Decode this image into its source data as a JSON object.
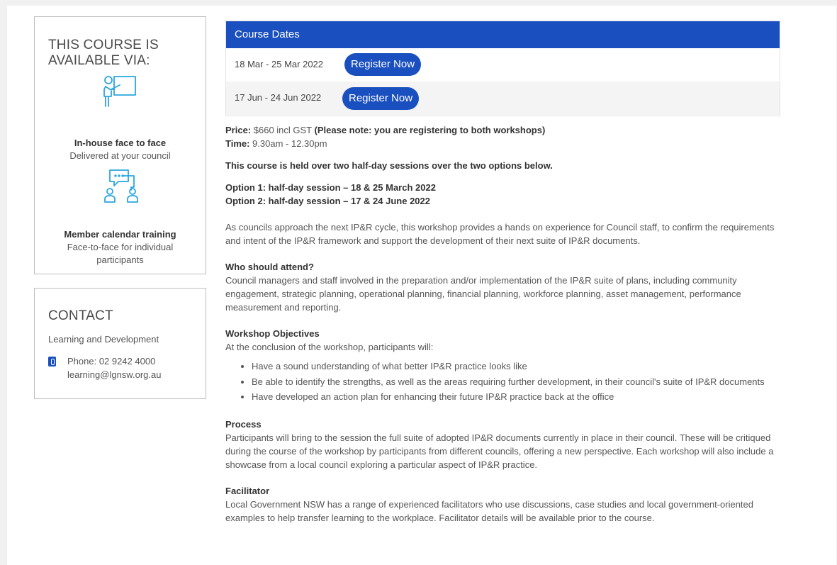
{
  "availability": {
    "title": "THIS COURSE IS AVAILABLE VIA:",
    "options": [
      {
        "icon": "presenter-icon",
        "title": "In-house face to face",
        "subtitle": "Delivered at your council"
      },
      {
        "icon": "discussion-icon",
        "title": "Member calendar training",
        "subtitle": "Face-to-face for individual participants"
      }
    ]
  },
  "contact": {
    "title": "CONTACT",
    "department": "Learning and Development",
    "phone": "Phone: 02 9242 4000",
    "email": "learning@lgnsw.org.au"
  },
  "course_dates": {
    "heading": "Course Dates",
    "rows": [
      {
        "date": "18 Mar - 25 Mar 2022",
        "button": "Register Now"
      },
      {
        "date": "17 Jun - 24 Jun 2022",
        "button": "Register Now"
      }
    ]
  },
  "details": {
    "price_label": "Price:",
    "price_value": " $660 incl GST ",
    "price_note": "(Please note: you are registering to both workshops)",
    "time_label": "Time:",
    "time_value": " 9.30am - 12.30pm",
    "held_over": "This course is held over two half-day sessions over the two options below.",
    "option1": "Option 1: half-day session – 18 & 25 March 2022",
    "option2": "Option 2: half-day session – 17 & 24 June 2022",
    "intro": "As councils approach the next IP&R cycle, this workshop provides a hands on experience for Council staff, to confirm the requirements and intent of the IP&R framework and support the development of their next suite of IP&R documents.",
    "who_heading": "Who should attend?",
    "who_text": "Council managers and staff involved in the preparation and/or implementation of the IP&R suite of plans, including community engagement, strategic planning, operational planning, financial planning, workforce planning, asset management, performance measurement and reporting.",
    "objectives_heading": "Workshop Objectives",
    "objectives_intro": "At the conclusion of the workshop, participants will:",
    "objectives": [
      "Have a sound understanding of what better IP&R practice looks like",
      "Be able to identify the strengths, as well as the areas requiring further development, in their council's suite of IP&R documents",
      "Have developed an action plan for enhancing their future IP&R practice back at the office"
    ],
    "process_heading": "Process",
    "process_text": "Participants will bring to the session the full suite of adopted IP&R documents currently in place in their council. These will be critiqued during the course of the workshop by participants from different councils, offering a new perspective. Each workshop will also include a showcase from a local council exploring a particular aspect of IP&R practice.",
    "facilitator_heading": "Facilitator",
    "facilitator_text": "Local Government NSW has a range of experienced facilitators who use discussions, case studies and local government-oriented examples to help transfer learning to the workplace. Facilitator details will be available prior to the course."
  },
  "colors": {
    "accent": "#1a4fbf",
    "icon": "#2aa6e0"
  }
}
